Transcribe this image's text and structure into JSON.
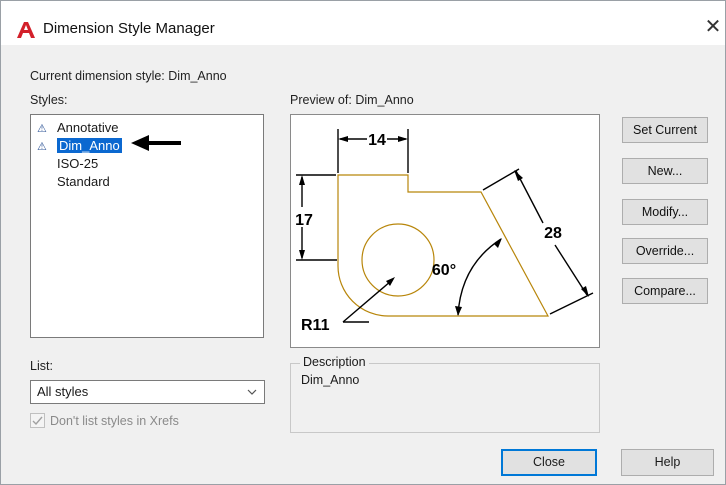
{
  "window": {
    "title": "Dimension Style Manager",
    "close_glyph": "✕",
    "app_icon": "autocad-a-icon"
  },
  "current_style": {
    "label": "Current dimension style:",
    "value": "Dim_Anno"
  },
  "styles": {
    "label": "Styles:",
    "items": [
      {
        "label": "Annotative",
        "annotative": true,
        "selected": false
      },
      {
        "label": "Dim_Anno",
        "annotative": true,
        "selected": true
      },
      {
        "label": "ISO-25",
        "annotative": false,
        "selected": false
      },
      {
        "label": "Standard",
        "annotative": false,
        "selected": false
      }
    ]
  },
  "preview": {
    "label": "Preview of:",
    "style_name": "Dim_Anno",
    "dims": {
      "top": "14",
      "left": "17",
      "diagonal": "28",
      "angle": "60°",
      "radius": "R11"
    }
  },
  "description": {
    "label": "Description",
    "value": "Dim_Anno"
  },
  "list": {
    "label": "List:",
    "selected": "All styles"
  },
  "xref_checkbox": {
    "label": "Don't list styles in Xrefs",
    "checked": true,
    "disabled": true
  },
  "buttons": {
    "set_current": "Set Current",
    "new": "New...",
    "modify": "Modify...",
    "override": "Override...",
    "compare": "Compare...",
    "close": "Close",
    "help": "Help"
  },
  "colors": {
    "selection": "#0b68d0",
    "geometry": "#b8860b",
    "dimension": "#000000",
    "annotative_icon": "#2f5597"
  }
}
